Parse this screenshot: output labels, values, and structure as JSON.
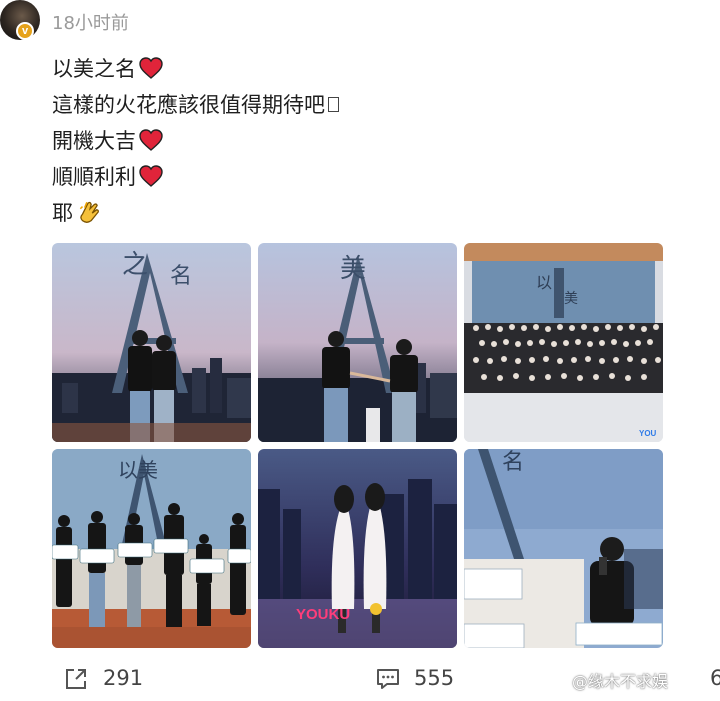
{
  "post": {
    "time": "18小时前",
    "lines": [
      {
        "text": "以美之名",
        "emoji": "red-heart"
      },
      {
        "text": "這樣的火花應該很值得期待吧",
        "emoji": "box-glyph"
      },
      {
        "text": "開機大吉",
        "emoji": "red-heart"
      },
      {
        "text": "順順利利",
        "emoji": "red-heart"
      },
      {
        "text": "耶",
        "emoji": "clapping-hands"
      }
    ],
    "badge": "v",
    "photos": [
      {
        "kind": "poster-pair"
      },
      {
        "kind": "poster-pair-holding-hands"
      },
      {
        "kind": "group-photo",
        "tag": "YOU"
      },
      {
        "kind": "event-signs"
      },
      {
        "kind": "illustration-youku",
        "brand": "YOUKU"
      },
      {
        "kind": "speaker-microphone"
      }
    ]
  },
  "actions": {
    "share_count": "291",
    "comment_count": "555",
    "like_count_partial": "6"
  },
  "watermark": "@缘木不求娱",
  "colors": {
    "accent_badge": "#e6a21b",
    "heart": "#e0243a",
    "muted_text": "#9a9a9a"
  }
}
